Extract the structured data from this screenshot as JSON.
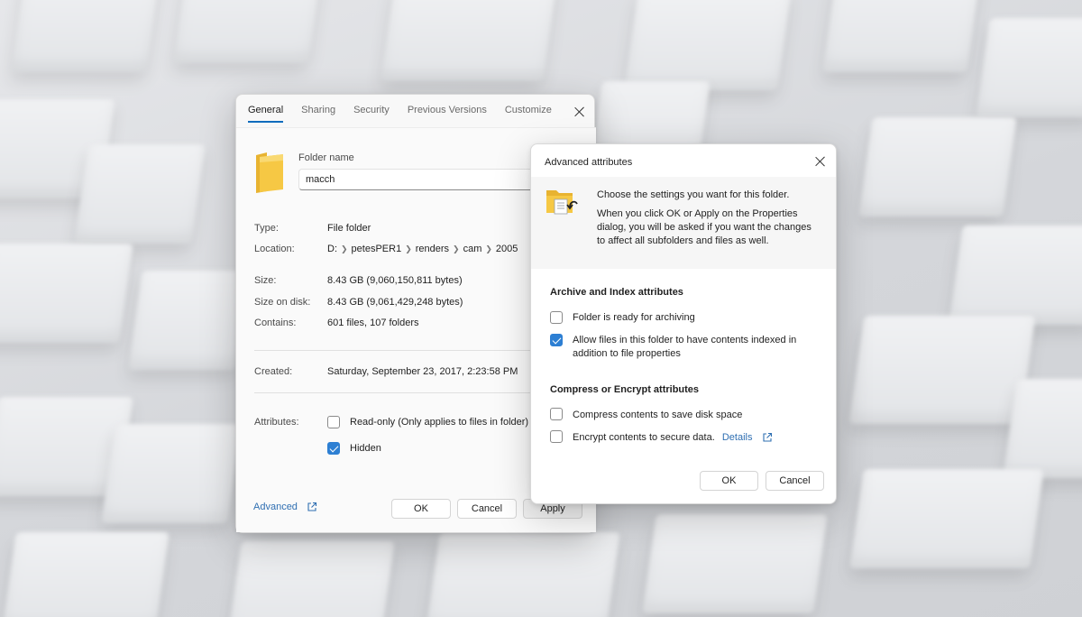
{
  "properties": {
    "tabs": [
      {
        "label": "General"
      },
      {
        "label": "Sharing"
      },
      {
        "label": "Security"
      },
      {
        "label": "Previous Versions"
      },
      {
        "label": "Customize"
      }
    ],
    "folder_name_label": "Folder name",
    "folder_name_value": "macch",
    "type_label": "Type:",
    "type_value": "File folder",
    "location_label": "Location:",
    "location_path": [
      "D:",
      "petesPER1",
      "renders",
      "cam",
      "2005"
    ],
    "size_label": "Size:",
    "size_value": "8.43 GB (9,060,150,811 bytes)",
    "size_on_disk_label": "Size on disk:",
    "size_on_disk_value": "8.43 GB (9,061,429,248 bytes)",
    "contains_label": "Contains:",
    "contains_value": "601 files, 107 folders",
    "created_label": "Created:",
    "created_value": "Saturday, September 23, 2017, 2:23:58 PM",
    "attributes_label": "Attributes:",
    "readonly_label": "Read-only (Only applies to files in folder)",
    "readonly_checked": false,
    "hidden_label": "Hidden",
    "hidden_checked": true,
    "advanced_link": "Advanced",
    "buttons": {
      "ok": "OK",
      "cancel": "Cancel",
      "apply": "Apply"
    }
  },
  "advanced": {
    "title": "Advanced attributes",
    "intro": "Choose the settings you want for this folder.",
    "description_lines": [
      "When you click OK or Apply on the Properties",
      "dialog, you will be asked if you want the changes",
      "to affect all subfolders and files as well."
    ],
    "archive_section": "Archive and Index attributes",
    "archive_option": "Folder is ready for archiving",
    "archive_checked": false,
    "index_option_lines": [
      "Allow files in this folder to have contents indexed in",
      "addition to file properties"
    ],
    "index_checked": true,
    "compress_section": "Compress or Encrypt attributes",
    "compress_option": "Compress contents to save disk space",
    "compress_checked": false,
    "encrypt_option": "Encrypt contents to secure data.",
    "encrypt_checked": false,
    "details_link": "Details",
    "buttons": {
      "ok": "OK",
      "cancel": "Cancel"
    }
  },
  "colors": {
    "accent": "#2d7fd3",
    "link": "#2f6fb2",
    "folder_yellow": "#f6c844"
  },
  "icons": [
    "folder-icon",
    "folder-settings-icon",
    "close-icon",
    "chevron-right-icon",
    "external-link-icon",
    "checkmark-icon"
  ]
}
